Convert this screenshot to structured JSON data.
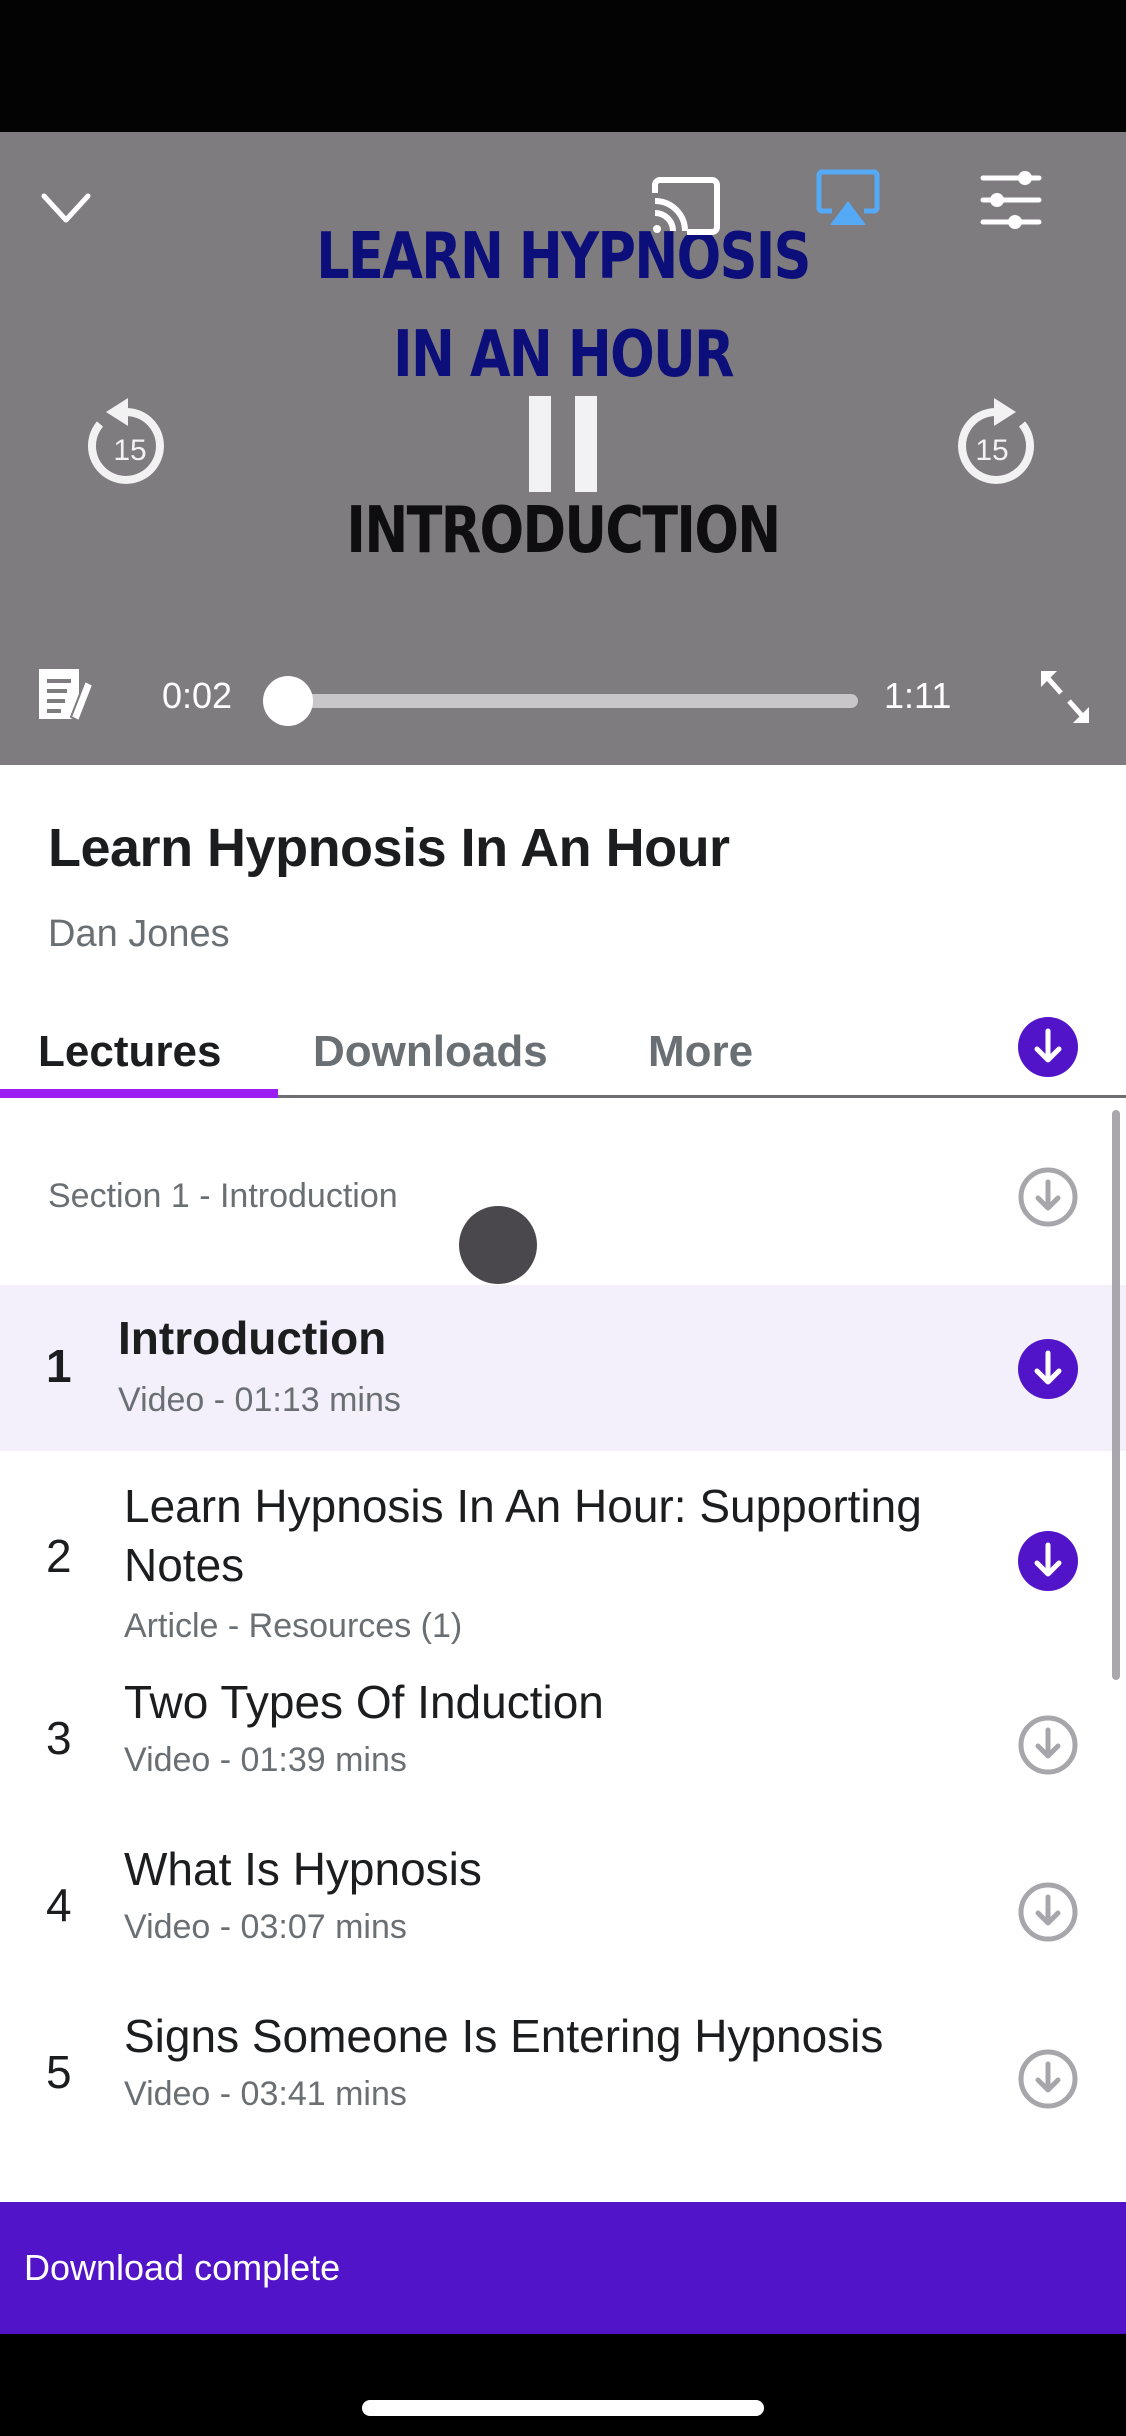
{
  "player": {
    "slide_lines": [
      "LEARN HYPNOSIS",
      "IN AN HOUR",
      "INTRODUCTION"
    ],
    "current_time": "0:02",
    "duration": "1:11",
    "progress_fraction": 0.028,
    "rewind_seconds": "15",
    "forward_seconds": "15",
    "state": "playing",
    "icons": {
      "collapse": "chevron-down-icon",
      "cast": "cast-icon",
      "airplay": "airplay-icon",
      "settings": "sliders-icon",
      "rewind": "rewind-15-icon",
      "pause": "pause-icon",
      "forward": "forward-15-icon",
      "notes": "notes-icon",
      "fullscreen": "fullscreen-icon"
    }
  },
  "course": {
    "title": "Learn Hypnosis In An Hour",
    "author": "Dan Jones"
  },
  "tabs": [
    {
      "label": "Lectures",
      "active": true
    },
    {
      "label": "Downloads",
      "active": false
    },
    {
      "label": "More",
      "active": false
    }
  ],
  "section": {
    "title": "Section 1 - Introduction",
    "downloaded": false
  },
  "lectures": [
    {
      "number": "1",
      "title": "Introduction",
      "subtitle": "Video - 01:13 mins",
      "downloaded": true,
      "active": true
    },
    {
      "number": "2",
      "title": "Learn Hypnosis In An Hour: Supporting Notes",
      "subtitle": "Article - Resources (1)",
      "downloaded": true,
      "active": false
    },
    {
      "number": "3",
      "title": "Two Types Of Induction",
      "subtitle": "Video - 01:39 mins",
      "downloaded": false,
      "active": false
    },
    {
      "number": "4",
      "title": "What Is Hypnosis",
      "subtitle": "Video - 03:07 mins",
      "downloaded": false,
      "active": false
    },
    {
      "number": "5",
      "title": "Signs Someone Is Entering Hypnosis",
      "subtitle": "Video - 03:41 mins",
      "downloaded": false,
      "active": false
    }
  ],
  "snackbar": {
    "message": "Download complete"
  },
  "colors": {
    "accent": "#5214c9",
    "tab_indicator": "#9b1ff2",
    "airplay_active": "#55a9f5",
    "active_row_bg": "#f4f0fb",
    "player_bg": "#7f7c80"
  }
}
